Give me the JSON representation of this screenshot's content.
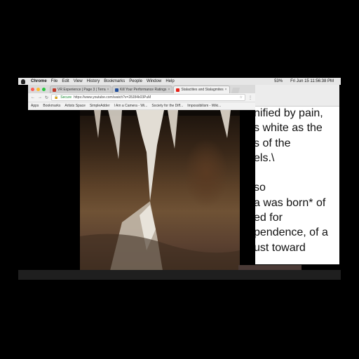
{
  "menubar": {
    "app": "Chrome",
    "items": [
      "File",
      "Edit",
      "View",
      "History",
      "Bookmarks",
      "People",
      "Window",
      "Help"
    ],
    "clock": "Fri Jun 15  11:56:38 PM",
    "battery": "53%"
  },
  "browser": {
    "tabs": [
      {
        "title": "VR Experience | Page 3 | Terra",
        "favicon_color": "#c0392b"
      },
      {
        "title": "Kill Your Performance Ratings",
        "favicon_color": "#1f4e9c"
      },
      {
        "title": "Stalactites and Stalagmites",
        "favicon_color": "#e62117"
      }
    ],
    "secure_label": "Secure",
    "url": "https://www.youtube.com/watch?v=28J84k03PuM",
    "bookmarks": [
      "Apps",
      "Bookmarks",
      "Artists Space",
      "SimpleAdder",
      "I Am a Camera - Wi...",
      "Society for the Diff...",
      "Impossibilism - Wiki..."
    ]
  },
  "editor": {
    "lines": [
      "nified by pain,",
      "s white as the",
      "s of the",
      "els.\\",
      "",
      "so",
      "a was born* of",
      "ed for",
      "pendence, of a",
      "ust toward",
      "."
    ]
  }
}
